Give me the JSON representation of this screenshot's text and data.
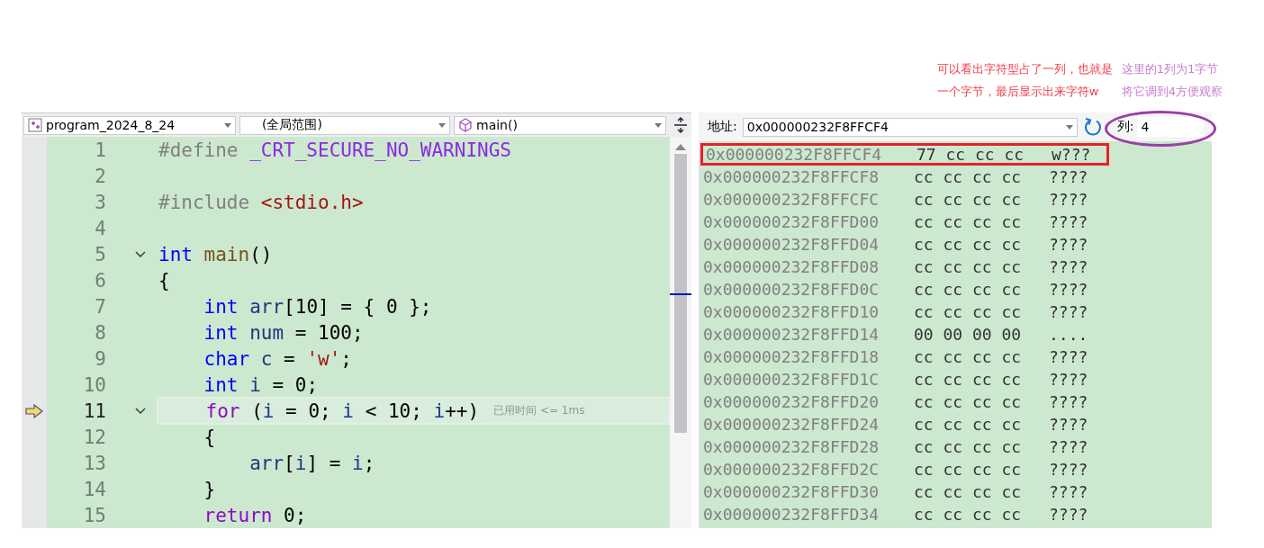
{
  "annotations": [
    {
      "lines": [
        "可以看出字符型占了一列，也就是",
        "一个字节，最后显示出来字符w"
      ],
      "color": "#f0404a"
    },
    {
      "lines": [
        "这里的1列为1字节",
        "将它调到4方便观察"
      ],
      "color": "#c77dcf"
    }
  ],
  "editor": {
    "project": "program_2024_8_24",
    "scope": "(全局范围)",
    "member": "main()",
    "lines": [
      {
        "number": "1",
        "fold": false,
        "current": false,
        "tokens": [
          {
            "t": "#define",
            "kind": "pre"
          },
          {
            "t": " _CRT_SECURE_NO_WARNINGS",
            "kind": "macro"
          }
        ]
      },
      {
        "number": "2",
        "fold": false,
        "current": false
      },
      {
        "number": "3",
        "fold": false,
        "current": false,
        "tokens": [
          {
            "t": "#include",
            "kind": "pre"
          },
          {
            "t": " <stdio.h>",
            "kind": "str"
          }
        ]
      },
      {
        "number": "4",
        "fold": false,
        "current": false
      },
      {
        "number": "5",
        "fold": true,
        "current": false,
        "tokens": [
          {
            "t": "int",
            "kind": "kw"
          },
          {
            "t": " main",
            "kind": "fn"
          },
          {
            "t": "()",
            "kind": "plain"
          }
        ]
      },
      {
        "number": "6",
        "fold": false,
        "current": false,
        "tokens": [
          {
            "t": "{",
            "kind": "plain"
          }
        ]
      },
      {
        "number": "7",
        "fold": false,
        "current": false,
        "tokens": [
          {
            "t": "    int",
            "kind": "kw"
          },
          {
            "t": " arr",
            "kind": "var"
          },
          {
            "t": "[10] = { 0 };",
            "kind": "plain"
          }
        ]
      },
      {
        "number": "8",
        "fold": false,
        "current": false,
        "tokens": [
          {
            "t": "    int",
            "kind": "kw"
          },
          {
            "t": " num",
            "kind": "var"
          },
          {
            "t": " = 100;",
            "kind": "plain"
          }
        ]
      },
      {
        "number": "9",
        "fold": false,
        "current": false,
        "tokens": [
          {
            "t": "    char",
            "kind": "kw"
          },
          {
            "t": " c",
            "kind": "var"
          },
          {
            "t": " = ",
            "kind": "plain"
          },
          {
            "t": "'w'",
            "kind": "str"
          },
          {
            "t": ";",
            "kind": "plain"
          }
        ]
      },
      {
        "number": "10",
        "fold": false,
        "current": false,
        "tokens": [
          {
            "t": "    int",
            "kind": "kw"
          },
          {
            "t": " i",
            "kind": "var"
          },
          {
            "t": " = 0;",
            "kind": "plain"
          }
        ]
      },
      {
        "number": "11",
        "fold": true,
        "current": true,
        "hint": "已用时间 <= 1ms",
        "tokens": [
          {
            "t": "    for",
            "kind": "ctl"
          },
          {
            "t": " (",
            "kind": "plain"
          },
          {
            "t": "i",
            "kind": "var"
          },
          {
            "t": " = 0; ",
            "kind": "plain"
          },
          {
            "t": "i",
            "kind": "var"
          },
          {
            "t": " < 10; ",
            "kind": "plain"
          },
          {
            "t": "i",
            "kind": "var"
          },
          {
            "t": "++)",
            "kind": "plain"
          }
        ]
      },
      {
        "number": "12",
        "fold": false,
        "current": false,
        "tokens": [
          {
            "t": "    {",
            "kind": "plain"
          }
        ]
      },
      {
        "number": "13",
        "fold": false,
        "current": false,
        "tokens": [
          {
            "t": "        arr",
            "kind": "var"
          },
          {
            "t": "[",
            "kind": "plain"
          },
          {
            "t": "i",
            "kind": "var"
          },
          {
            "t": "] = ",
            "kind": "plain"
          },
          {
            "t": "i",
            "kind": "var"
          },
          {
            "t": ";",
            "kind": "plain"
          }
        ]
      },
      {
        "number": "14",
        "fold": false,
        "current": false,
        "tokens": [
          {
            "t": "    }",
            "kind": "plain"
          }
        ]
      },
      {
        "number": "15",
        "fold": false,
        "current": false,
        "tokens": [
          {
            "t": "    return",
            "kind": "ctl"
          },
          {
            "t": " 0;",
            "kind": "plain"
          }
        ]
      }
    ]
  },
  "memory": {
    "address_label": "地址:",
    "address": "0x000000232F8FFCF4",
    "columns_label": "列:",
    "columns": "4",
    "columns_circled": true,
    "rows": [
      {
        "address": "0x000000232F8FFCF4",
        "bytes": "77 cc cc cc",
        "chars": "w???",
        "highlighted": true
      },
      {
        "address": "0x000000232F8FFCF8",
        "bytes": "cc cc cc cc",
        "chars": "????",
        "highlighted": false
      },
      {
        "address": "0x000000232F8FFCFC",
        "bytes": "cc cc cc cc",
        "chars": "????",
        "highlighted": false
      },
      {
        "address": "0x000000232F8FFD00",
        "bytes": "cc cc cc cc",
        "chars": "????",
        "highlighted": false
      },
      {
        "address": "0x000000232F8FFD04",
        "bytes": "cc cc cc cc",
        "chars": "????",
        "highlighted": false
      },
      {
        "address": "0x000000232F8FFD08",
        "bytes": "cc cc cc cc",
        "chars": "????",
        "highlighted": false
      },
      {
        "address": "0x000000232F8FFD0C",
        "bytes": "cc cc cc cc",
        "chars": "????",
        "highlighted": false
      },
      {
        "address": "0x000000232F8FFD10",
        "bytes": "cc cc cc cc",
        "chars": "????",
        "highlighted": false
      },
      {
        "address": "0x000000232F8FFD14",
        "bytes": "00 00 00 00",
        "chars": "....",
        "highlighted": false
      },
      {
        "address": "0x000000232F8FFD18",
        "bytes": "cc cc cc cc",
        "chars": "????",
        "highlighted": false
      },
      {
        "address": "0x000000232F8FFD1C",
        "bytes": "cc cc cc cc",
        "chars": "????",
        "highlighted": false
      },
      {
        "address": "0x000000232F8FFD20",
        "bytes": "cc cc cc cc",
        "chars": "????",
        "highlighted": false
      },
      {
        "address": "0x000000232F8FFD24",
        "bytes": "cc cc cc cc",
        "chars": "????",
        "highlighted": false
      },
      {
        "address": "0x000000232F8FFD28",
        "bytes": "cc cc cc cc",
        "chars": "????",
        "highlighted": false
      },
      {
        "address": "0x000000232F8FFD2C",
        "bytes": "cc cc cc cc",
        "chars": "????",
        "highlighted": false
      },
      {
        "address": "0x000000232F8FFD30",
        "bytes": "cc cc cc cc",
        "chars": "????",
        "highlighted": false
      },
      {
        "address": "0x000000232F8FFD34",
        "bytes": "cc cc cc cc",
        "chars": "????",
        "highlighted": false
      }
    ]
  }
}
